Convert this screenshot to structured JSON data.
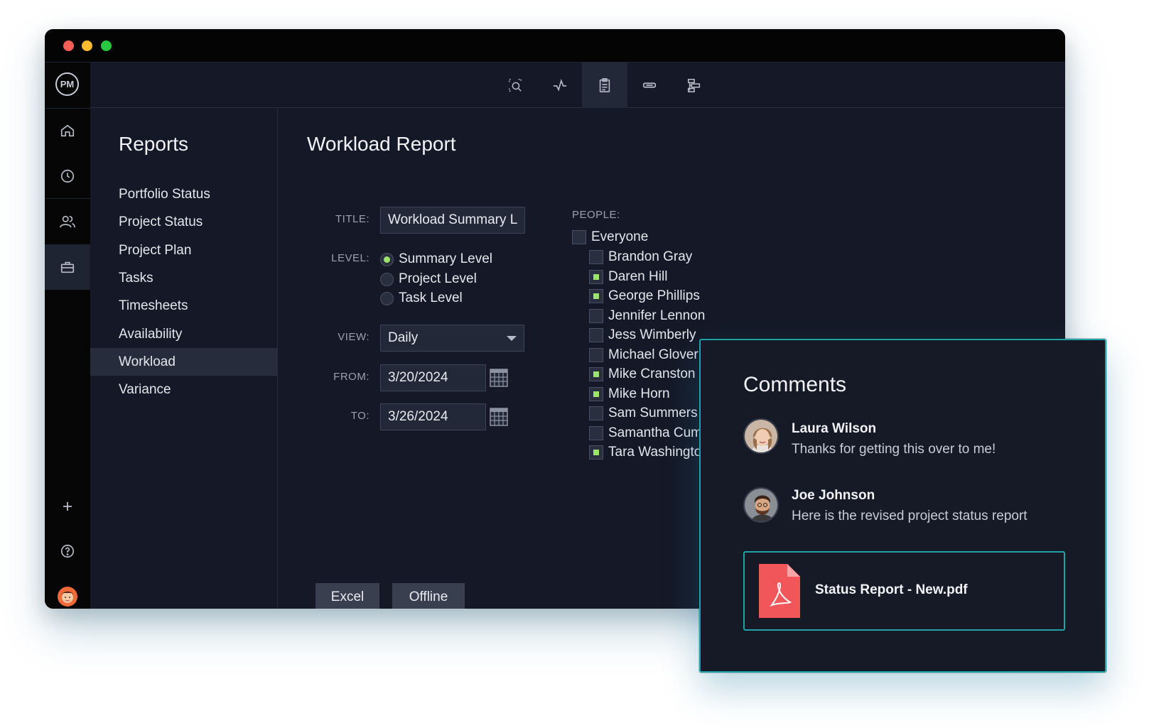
{
  "app": {
    "logo_text": "PM",
    "window_controls": [
      "close",
      "minimize",
      "maximize"
    ]
  },
  "rail": {
    "icons": [
      "home-icon",
      "clock-icon",
      "people-icon",
      "briefcase-icon",
      "plus-icon",
      "help-icon",
      "user-avatar"
    ],
    "active": "briefcase-icon"
  },
  "toolbar": {
    "icons": [
      "search-zoom-icon",
      "activity-icon",
      "clipboard-icon",
      "link-icon",
      "hierarchy-icon"
    ],
    "active": "clipboard-icon"
  },
  "sidebar": {
    "title": "Reports",
    "items": [
      {
        "label": "Portfolio Status"
      },
      {
        "label": "Project Status"
      },
      {
        "label": "Project Plan"
      },
      {
        "label": "Tasks"
      },
      {
        "label": "Timesheets"
      },
      {
        "label": "Availability"
      },
      {
        "label": "Workload",
        "active": true
      },
      {
        "label": "Variance"
      }
    ]
  },
  "report": {
    "title": "Workload Report",
    "title_label": "TITLE:",
    "title_value": "Workload Summary L",
    "level_label": "LEVEL:",
    "levels": [
      {
        "label": "Summary Level",
        "selected": true
      },
      {
        "label": "Project Level",
        "selected": false
      },
      {
        "label": "Task Level",
        "selected": false
      }
    ],
    "view_label": "VIEW:",
    "view_value": "Daily",
    "from_label": "FROM:",
    "from_value": "3/20/2024",
    "to_label": "TO:",
    "to_value": "3/26/2024",
    "buttons": {
      "excel": "Excel",
      "offline": "Offline"
    }
  },
  "people": {
    "label": "PEOPLE:",
    "everyone": {
      "label": "Everyone",
      "checked": false
    },
    "list": [
      {
        "name": "Brandon Gray",
        "checked": false
      },
      {
        "name": "Daren Hill",
        "checked": true
      },
      {
        "name": "George Phillips",
        "checked": true
      },
      {
        "name": "Jennifer Lennon",
        "checked": false
      },
      {
        "name": "Jess Wimberly",
        "checked": false
      },
      {
        "name": "Michael Glover",
        "checked": false
      },
      {
        "name": "Mike Cranston",
        "checked": true
      },
      {
        "name": "Mike Horn",
        "checked": true
      },
      {
        "name": "Sam Summers",
        "checked": false
      },
      {
        "name": "Samantha Cummings",
        "checked": false
      },
      {
        "name": "Tara Washington",
        "checked": true
      }
    ]
  },
  "comments": {
    "title": "Comments",
    "items": [
      {
        "author": "Laura Wilson",
        "text": "Thanks for getting this over to me!"
      },
      {
        "author": "Joe Johnson",
        "text": "Here is the revised project status report"
      }
    ],
    "attachment": {
      "name": "Status Report - New.pdf",
      "icon": "pdf-icon"
    }
  },
  "colors": {
    "accent_green": "#9be36a",
    "panel_border": "#1fa3a8",
    "pdf_red": "#f0565a",
    "window_bg": "#151927"
  }
}
